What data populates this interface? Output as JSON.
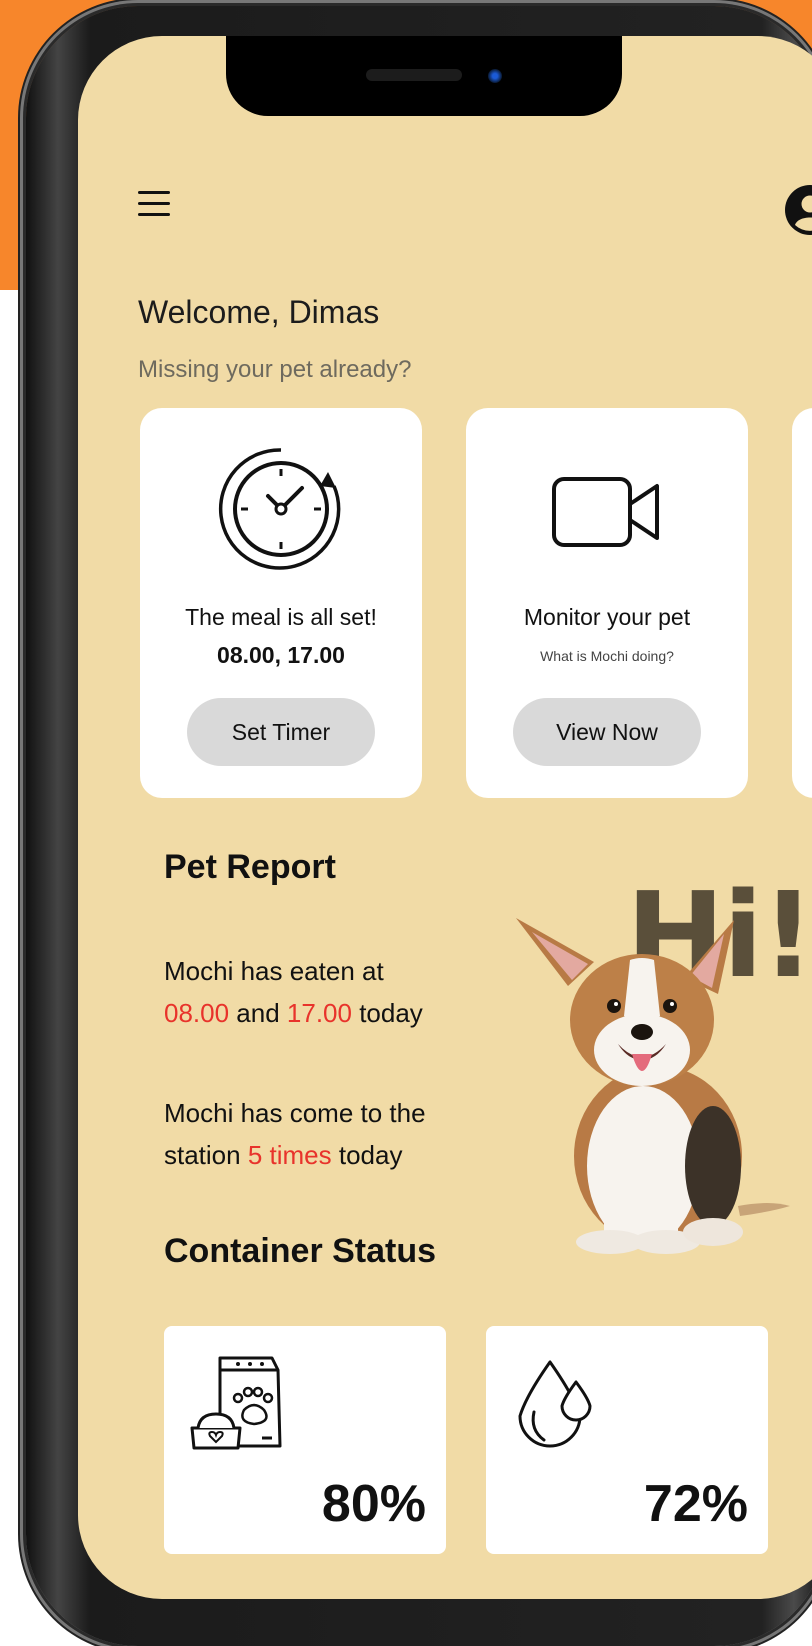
{
  "header": {
    "welcome": "Welcome, Dimas",
    "subtitle": "Missing your pet already?"
  },
  "cards": [
    {
      "title": "The meal is all set!",
      "detail": "08.00, 17.00",
      "button": "Set Timer"
    },
    {
      "title": "Monitor your pet",
      "detail": "What is Mochi doing?",
      "button": "View Now"
    }
  ],
  "pet_report": {
    "title": "Pet Report",
    "line1_a": "Mochi has eaten at",
    "line1_t1": "08.00",
    "line1_and": " and ",
    "line1_t2": "17.00",
    "line1_b": " today",
    "line2_a": "Mochi has come to the",
    "line2_b": "station ",
    "line2_count": "5 times",
    "line2_c": " today",
    "greeting": "Hi!"
  },
  "container_status": {
    "title": "Container Status",
    "food_percent": "80%",
    "water_percent": "72%"
  },
  "colors": {
    "orange_background": "#f7862b",
    "screen_background": "#f1dba6",
    "highlight_red": "#e8332b"
  },
  "icons": [
    "menu-icon",
    "profile-icon",
    "timer-clock-icon",
    "video-camera-icon",
    "pet-food-icon",
    "water-drop-icon"
  ]
}
